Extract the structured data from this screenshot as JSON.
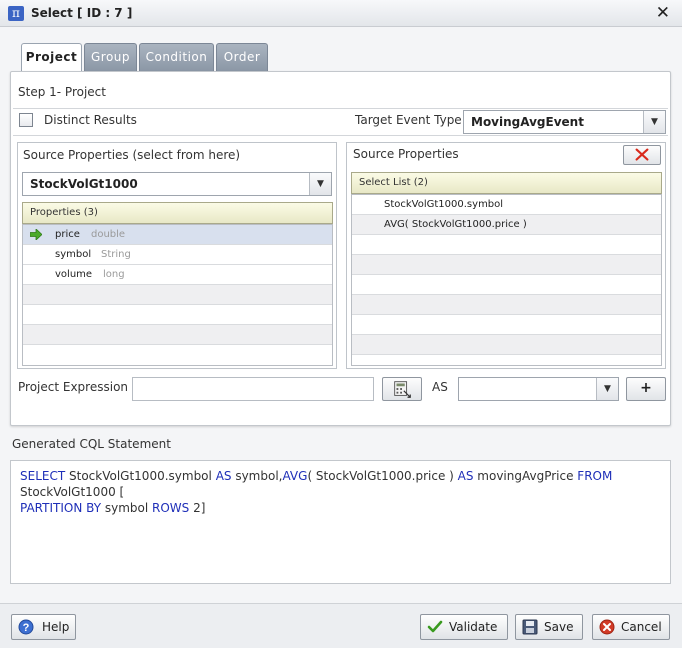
{
  "window": {
    "title": "Select [ ID : 7 ]",
    "close_icon": "close-icon"
  },
  "tabs": [
    {
      "label": "Project",
      "active": true
    },
    {
      "label": "Group",
      "active": false
    },
    {
      "label": "Condition",
      "active": false
    },
    {
      "label": "Order",
      "active": false
    }
  ],
  "step_title": "Step 1- Project",
  "distinct_results": {
    "label": "Distinct Results",
    "checked": false
  },
  "target_event_type": {
    "label": "Target Event Type",
    "value": "MovingAvgEvent"
  },
  "source_left": {
    "title": "Source Properties (select from here)",
    "source": "StockVolGt1000",
    "grid_header": "Properties (3)",
    "properties": [
      {
        "name": "price",
        "type": "double",
        "selected": true
      },
      {
        "name": "symbol",
        "type": "String",
        "selected": false
      },
      {
        "name": "volume",
        "type": "long",
        "selected": false
      }
    ]
  },
  "source_right": {
    "title": "Source Properties",
    "grid_header": "Select List (2)",
    "items": [
      "StockVolGt1000.symbol",
      "AVG( StockVolGt1000.price )"
    ]
  },
  "project_expression": {
    "label": "Project Expression",
    "value": "",
    "as_label": "AS",
    "alias": "",
    "add_label": "+"
  },
  "cql": {
    "title": "Generated CQL Statement",
    "tokens": [
      {
        "t": "SELECT",
        "kw": true
      },
      {
        "t": " StockVolGt1000.symbol ",
        "kw": false
      },
      {
        "t": "AS",
        "kw": true
      },
      {
        "t": " symbol,",
        "kw": false
      },
      {
        "t": "AVG",
        "kw": true
      },
      {
        "t": "( StockVolGt1000.price ) ",
        "kw": false
      },
      {
        "t": "AS",
        "kw": true
      },
      {
        "t": " movingAvgPrice ",
        "kw": false
      },
      {
        "t": "FROM",
        "kw": true
      },
      {
        "t": " StockVolGt1000  [",
        "kw": false
      }
    ],
    "tokens_line2": [
      {
        "t": "PARTITION BY",
        "kw": true
      },
      {
        "t": " symbol  ",
        "kw": false
      },
      {
        "t": "ROWS",
        "kw": true
      },
      {
        "t": " 2]",
        "kw": false
      }
    ]
  },
  "footer": {
    "help": "Help",
    "validate": "Validate",
    "save": "Save",
    "cancel": "Cancel"
  },
  "colors": {
    "keyword": "#1f2fb8",
    "tab_inactive": "#8b97a6",
    "selected_row": "#d8e0ee"
  }
}
